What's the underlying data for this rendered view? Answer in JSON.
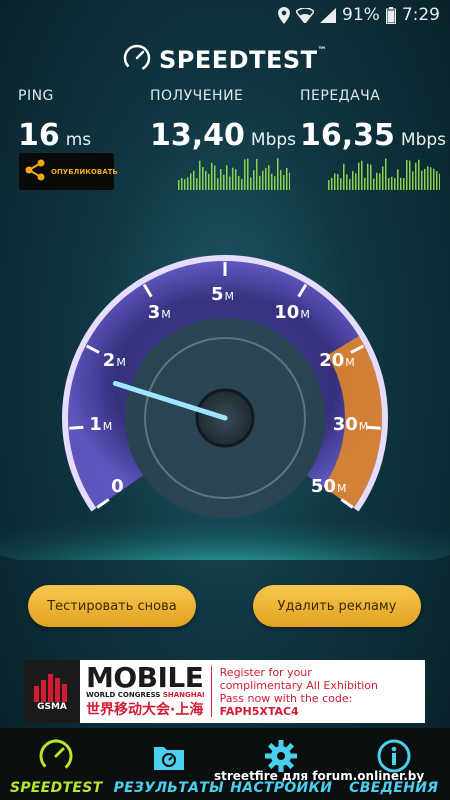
{
  "status_bar": {
    "battery": "91%",
    "time": "7:29"
  },
  "header": {
    "title": "SPEEDTEST",
    "trademark": "™"
  },
  "metrics": {
    "ping": {
      "label": "PING",
      "value": "16",
      "unit": "ms"
    },
    "download": {
      "label": "ПОЛУЧЕНИЕ",
      "value": "13,40",
      "unit": "Mbps"
    },
    "upload": {
      "label": "ПЕРЕДАЧА",
      "value": "16,35",
      "unit": "Mbps"
    }
  },
  "share": {
    "label": "ОПУБЛИКОВАТЬ"
  },
  "gauge": {
    "unit": "M",
    "ticks": [
      {
        "num": "0",
        "suffix": ""
      },
      {
        "num": "1",
        "suffix": "M"
      },
      {
        "num": "2",
        "suffix": "M"
      },
      {
        "num": "3",
        "suffix": "M"
      },
      {
        "num": "5",
        "suffix": "M"
      },
      {
        "num": "10",
        "suffix": "M"
      },
      {
        "num": "20",
        "suffix": "M"
      },
      {
        "num": "30",
        "suffix": "M"
      },
      {
        "num": "50",
        "suffix": "M"
      }
    ],
    "needle_position": 0.21,
    "colors": {
      "arc": "#e6dcff",
      "accent": "#e0862a",
      "needle": "#9ee6ff"
    }
  },
  "buttons": {
    "retest": "Тестировать снова",
    "remove_ads": "Удалить рекламу"
  },
  "ad": {
    "brand": "GSMA",
    "mobile": "MOBILE",
    "sub_a": "WORLD CONGRESS",
    "sub_b": "SHANGHAI",
    "chinese": "世界移动大会·上海",
    "lines": [
      "Register for your",
      "complimentary All Exhibition",
      "Pass now with the code:",
      "FAPH5XTAC4"
    ]
  },
  "nav": [
    {
      "label": "SPEEDTEST",
      "icon": "speedometer-icon"
    },
    {
      "label": "РЕЗУЛЬТАТЫ",
      "icon": "results-folder-icon"
    },
    {
      "label": "НАСТРОЙКИ",
      "icon": "gear-icon"
    },
    {
      "label": "СВЕДЕНИЯ",
      "icon": "info-icon"
    }
  ],
  "watermark": "streetfire для forum.onliner.by",
  "colors": {
    "active_nav": "#b6e52f",
    "nav": "#4bd0ef",
    "button": "#f0b83a",
    "spark": "#8ed14f"
  }
}
